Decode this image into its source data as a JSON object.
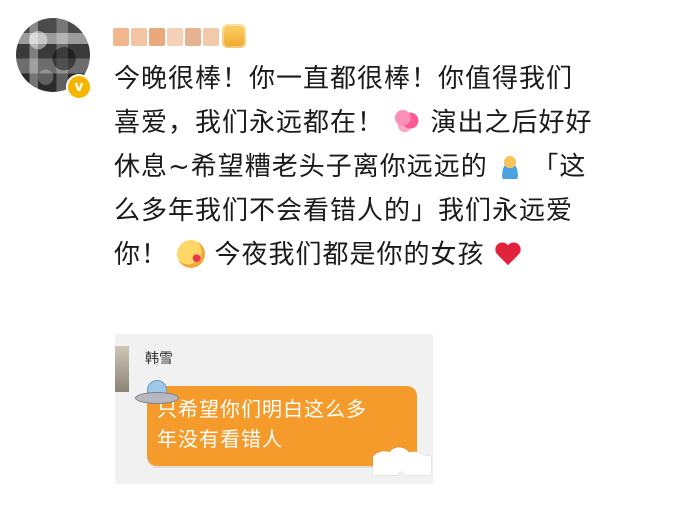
{
  "post": {
    "lines": [
      [
        "今晚很棒！你一直都很棒！你值得我们"
      ],
      [
        "喜爱，我们永远都在！",
        "hearts-emoji",
        "演出之后好好"
      ],
      [
        "休息~希望糟老头子离你远远的",
        "person-emoji",
        "「这"
      ],
      [
        "么多年我们不会看错人的」我们永远爱"
      ],
      [
        "你！",
        "kiss-emoji",
        "今夜我们都是你的女孩",
        "heart-emoji"
      ]
    ]
  },
  "embedded": {
    "sender": "韩雪",
    "message_line1": "只希望你们明白这么多",
    "message_line2": "年没有看错人"
  },
  "colors": {
    "bubble": "#f59b2b",
    "verified": "#f7b500"
  }
}
